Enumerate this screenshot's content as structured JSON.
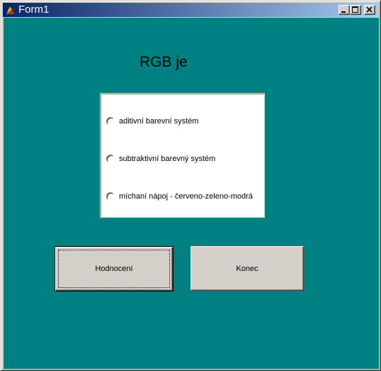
{
  "window": {
    "title": "Form1"
  },
  "titlebar_buttons": [
    "minimize-icon",
    "maximize-icon",
    "close-icon"
  ],
  "form": {
    "heading": "RGB je",
    "options": [
      {
        "label": "aditivní  barevní systém",
        "selected": false
      },
      {
        "label": "subtraktivní barevný systém",
        "selected": false
      },
      {
        "label": "míchaní nápoj - červeno-zeleno-modrá",
        "selected": false
      }
    ],
    "buttons": {
      "evaluate": "Hodnocení",
      "end": "Konec"
    }
  },
  "colors": {
    "client_background": "#008080",
    "titlebar_start": "#0a246a",
    "titlebar_end": "#a6caf0",
    "button_face": "#d4d0c8"
  }
}
